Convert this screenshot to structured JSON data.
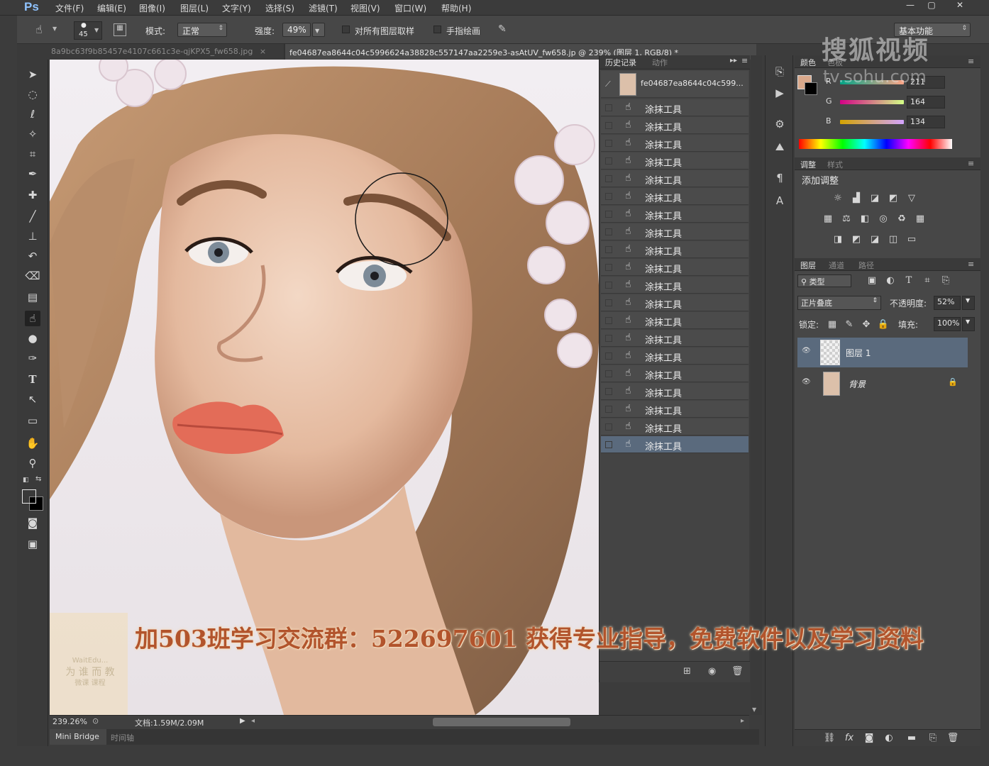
{
  "menu": {
    "logo": "Ps",
    "items": [
      "文件(F)",
      "编辑(E)",
      "图像(I)",
      "图层(L)",
      "文字(Y)",
      "选择(S)",
      "滤镜(T)",
      "视图(V)",
      "窗口(W)",
      "帮助(H)"
    ],
    "window_controls": [
      "—",
      "▢",
      "✕"
    ]
  },
  "options": {
    "brush_size": "45",
    "mode_label": "模式:",
    "mode_value": "正常",
    "strength_label": "强度:",
    "strength_value": "49%",
    "sample_all_layers": "对所有图层取样",
    "finger_painting": "手指绘画",
    "workspace": "基本功能"
  },
  "tabs": [
    {
      "label": "8a9bc63f9b85457e4107c661c3e-qjKPX5_fw658.jpg",
      "close": "×"
    },
    {
      "label": "fe04687ea8644c04c5996624a38828c557147aa2259e3-asAtUV_fw658.jp @ 239% (图层 1, RGB/8) *",
      "close": "×"
    }
  ],
  "status": {
    "zoom": "239.26%",
    "doc": "文档:1.59M/2.09M"
  },
  "bottom_tabs": [
    "Mini Bridge",
    "时间轴"
  ],
  "history": {
    "tabs": [
      "历史记录",
      "动作"
    ],
    "snapshot_label": "fe04687ea8644c04c599...",
    "items": [
      "涂抹工具",
      "涂抹工具",
      "涂抹工具",
      "涂抹工具",
      "涂抹工具",
      "涂抹工具",
      "涂抹工具",
      "涂抹工具",
      "涂抹工具",
      "涂抹工具",
      "涂抹工具",
      "涂抹工具",
      "涂抹工具",
      "涂抹工具",
      "涂抹工具",
      "涂抹工具",
      "涂抹工具",
      "涂抹工具",
      "涂抹工具",
      "涂抹工具"
    ]
  },
  "color_panel": {
    "tabs": [
      "颜色",
      "色板"
    ],
    "foreground": "#d9a88b",
    "channels": [
      {
        "name": "R",
        "value": "211"
      },
      {
        "name": "G",
        "value": "164"
      },
      {
        "name": "B",
        "value": "134"
      }
    ]
  },
  "adjustments": {
    "tabs": [
      "调整",
      "样式"
    ],
    "title": "添加调整"
  },
  "layers_panel": {
    "tabs": [
      "图层",
      "通道",
      "路径"
    ],
    "filter": "类型",
    "blend_mode": "正片叠底",
    "opacity_label": "不透明度:",
    "opacity": "52%",
    "lock_label": "锁定:",
    "fill_label": "填充:",
    "fill": "100%",
    "layers": [
      {
        "name": "图层 1",
        "selected": true
      },
      {
        "name": "背景",
        "selected": false
      }
    ]
  },
  "watermark": {
    "brand": "搜狐视频",
    "url": "tv.sohu.com"
  },
  "overlay_logo": {
    "line1": "WaitEdu...",
    "line2": "为 谁 而 教",
    "line3": "微课   课程"
  },
  "subtitle": "加503班学习交流群：522697601 获得专业指导，免费软件以及学习资料"
}
